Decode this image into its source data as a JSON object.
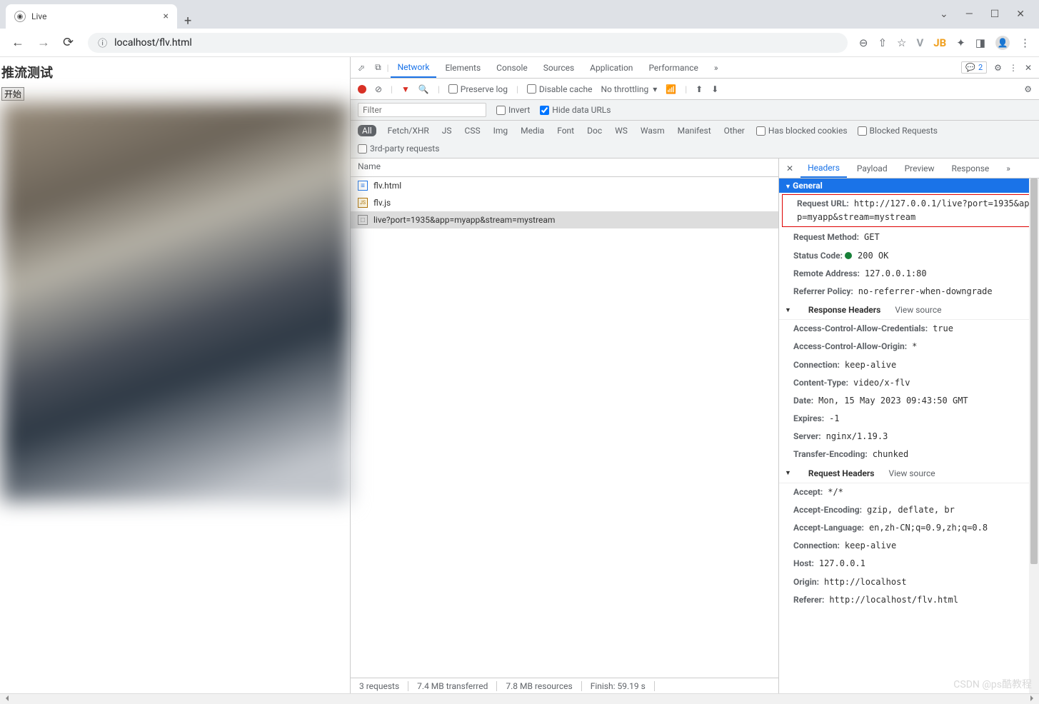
{
  "window": {
    "tab_title": "Live",
    "minimize": "—",
    "maximize": "☐",
    "close": "✕",
    "down": "⌄",
    "new_tab": "+"
  },
  "toolbar": {
    "url": "localhost/flv.html",
    "info": "ⓘ",
    "back": "←",
    "forward": "→",
    "reload": "⟳"
  },
  "page": {
    "title": "推流测试",
    "start_btn": "开始"
  },
  "devtools": {
    "tabs": [
      "Network",
      "Elements",
      "Console",
      "Sources",
      "Application",
      "Performance"
    ],
    "active_tab": "Network",
    "more": "»",
    "issues_count": "2",
    "gear": "⚙",
    "kebab": "⋮",
    "close": "✕"
  },
  "net_toolbar": {
    "preserve": "Preserve log",
    "disable_cache": "Disable cache",
    "throttling": "No throttling"
  },
  "filter": {
    "placeholder": "Filter",
    "invert": "Invert",
    "hide_urls": "Hide data URLs",
    "types": [
      "All",
      "Fetch/XHR",
      "JS",
      "CSS",
      "Img",
      "Media",
      "Font",
      "Doc",
      "WS",
      "Wasm",
      "Manifest",
      "Other"
    ],
    "blocked_cookies": "Has blocked cookies",
    "blocked_req": "Blocked Requests",
    "third_party": "3rd-party requests"
  },
  "requests": {
    "header": "Name",
    "list": [
      {
        "icon": "doc",
        "name": "flv.html"
      },
      {
        "icon": "js",
        "name": "flv.js"
      },
      {
        "icon": "other",
        "name": "live?port=1935&app=myapp&stream=mystream",
        "selected": true
      }
    ]
  },
  "detail_tabs": {
    "items": [
      "Headers",
      "Payload",
      "Preview",
      "Response"
    ],
    "active": "Headers",
    "more": "»"
  },
  "headers": {
    "general_title": "General",
    "general": [
      {
        "k": "Request URL:",
        "v": "http://127.0.0.1/live?port=1935&app=myapp&stream=mystream",
        "boxed": true
      },
      {
        "k": "Request Method:",
        "v": "GET"
      },
      {
        "k": "Status Code:",
        "v": "200 OK",
        "status": true
      },
      {
        "k": "Remote Address:",
        "v": "127.0.0.1:80"
      },
      {
        "k": "Referrer Policy:",
        "v": "no-referrer-when-downgrade"
      }
    ],
    "resp_title": "Response Headers",
    "view_source": "View source",
    "response": [
      {
        "k": "Access-Control-Allow-Credentials:",
        "v": "true"
      },
      {
        "k": "Access-Control-Allow-Origin:",
        "v": "*"
      },
      {
        "k": "Connection:",
        "v": "keep-alive"
      },
      {
        "k": "Content-Type:",
        "v": "video/x-flv"
      },
      {
        "k": "Date:",
        "v": "Mon, 15 May 2023 09:43:50 GMT"
      },
      {
        "k": "Expires:",
        "v": "-1"
      },
      {
        "k": "Server:",
        "v": "nginx/1.19.3"
      },
      {
        "k": "Transfer-Encoding:",
        "v": "chunked"
      }
    ],
    "req_title": "Request Headers",
    "request": [
      {
        "k": "Accept:",
        "v": "*/*"
      },
      {
        "k": "Accept-Encoding:",
        "v": "gzip, deflate, br"
      },
      {
        "k": "Accept-Language:",
        "v": "en,zh-CN;q=0.9,zh;q=0.8"
      },
      {
        "k": "Connection:",
        "v": "keep-alive"
      },
      {
        "k": "Host:",
        "v": "127.0.0.1"
      },
      {
        "k": "Origin:",
        "v": "http://localhost"
      },
      {
        "k": "Referer:",
        "v": "http://localhost/flv.html"
      }
    ]
  },
  "status": {
    "requests": "3 requests",
    "transferred": "7.4 MB transferred",
    "resources": "7.8 MB resources",
    "finish": "Finish: 59.19 s"
  },
  "watermark": "CSDN @ps酷教程"
}
